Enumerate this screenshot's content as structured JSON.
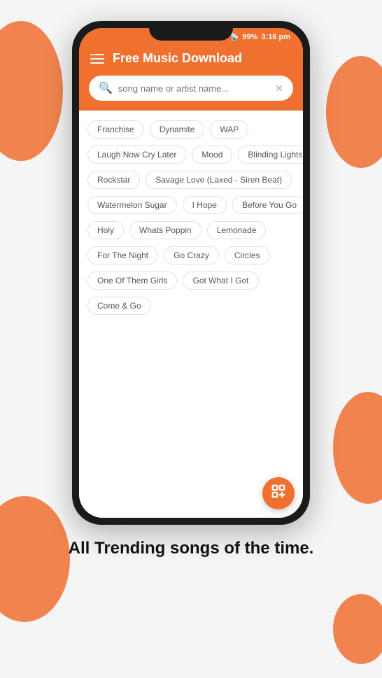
{
  "page": {
    "background_blobs": true
  },
  "status_bar": {
    "battery": "99%",
    "time": "3:16 pm",
    "icons": [
      "alarm",
      "wifi",
      "signal"
    ]
  },
  "header": {
    "title": "Free Music Download",
    "menu_icon": "hamburger"
  },
  "search": {
    "placeholder": "song name or artist name...",
    "clear_icon": "✕"
  },
  "tags": [
    [
      "Franchise",
      "Dynamite",
      "WAP"
    ],
    [
      "Laugh Now Cry Later",
      "Mood",
      "Blinding Lights"
    ],
    [
      "Rockstar",
      "Savage Love (Laxed - Siren Beat)"
    ],
    [
      "Watermelon Sugar",
      "I Hope",
      "Before You Go"
    ],
    [
      "Holy",
      "Whats Poppin",
      "Lemonade"
    ],
    [
      "For The Night",
      "Go Crazy",
      "Circles"
    ],
    [
      "One Of Them Girls",
      "Got What I Got"
    ],
    [
      "Come & Go"
    ]
  ],
  "fab": {
    "icon": "download"
  },
  "bottom_text": "All Trending songs of the time."
}
